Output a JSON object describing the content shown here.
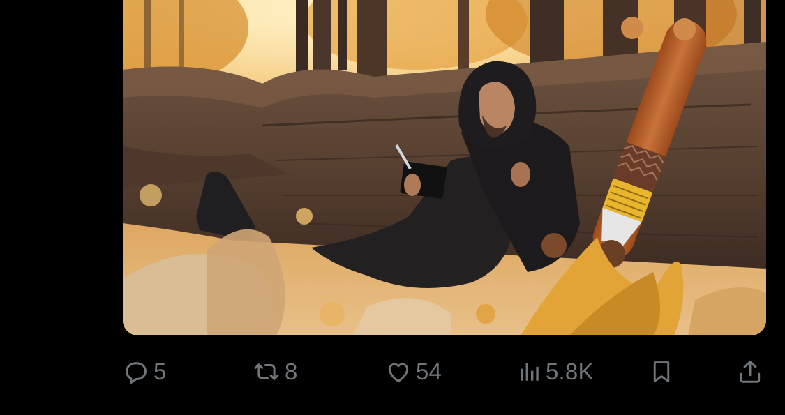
{
  "post": {
    "media": {
      "alt": "",
      "colors": {
        "sky": "#f6c76c",
        "leaves": "#e0a03a",
        "log": "#5b4333",
        "hoodie": "#1f1c1d",
        "board": "#b75f2a"
      }
    },
    "actions": {
      "reply": {
        "icon": "reply-icon",
        "count": "5"
      },
      "repost": {
        "icon": "repost-icon",
        "count": "8"
      },
      "like": {
        "icon": "heart-icon",
        "count": "54"
      },
      "views": {
        "icon": "views-icon",
        "count": "5.8K"
      },
      "bookmark": {
        "icon": "bookmark-icon"
      },
      "share": {
        "icon": "share-icon"
      }
    },
    "colors": {
      "background": "#000000",
      "icon": "#71767b"
    }
  }
}
